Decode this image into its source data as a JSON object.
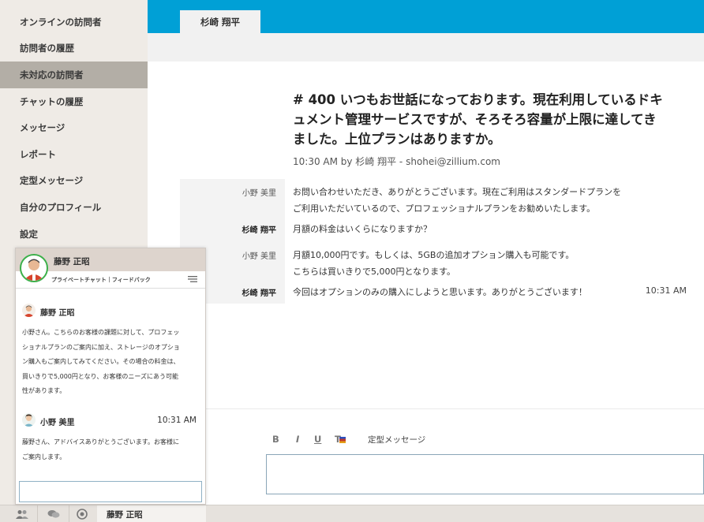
{
  "sidebar": {
    "items": [
      {
        "label": "オンラインの訪問者",
        "active": false
      },
      {
        "label": "訪問者の履歴",
        "active": false
      },
      {
        "label": "未対応の訪問者",
        "active": true
      },
      {
        "label": "チャットの履歴",
        "active": false
      },
      {
        "label": "メッセージ",
        "active": false
      },
      {
        "label": "レポート",
        "active": false
      },
      {
        "label": "定型メッセージ",
        "active": false
      },
      {
        "label": "自分のプロフィール",
        "active": false
      },
      {
        "label": "設定",
        "active": false
      }
    ]
  },
  "topbar": {
    "tab_label": "杉崎 翔平",
    "color": "#00a0d6"
  },
  "conversation": {
    "title": "# 400  いつもお世話になっております。現在利用しているドキュメント管理サービスですが、そろそろ容量が上限に達してきました。上位プランはありますか。",
    "meta": "10:30 AM by 杉崎 翔平 -  shohei@zillium.com",
    "messages": [
      {
        "sender": "小野 美里",
        "lines": [
          "お問い合わせいただき、ありがとうございます。現在ご利用はスタンダードプランを",
          "ご利用いただいているので、プロフェッショナルプランをお勧めいたします。"
        ],
        "time": ""
      },
      {
        "sender": "杉崎 翔平",
        "lines": [
          "月額の料金はいくらになりますか？"
        ],
        "time": ""
      },
      {
        "sender": "小野 美里",
        "lines": [
          "月額10,000円です。もしくは、5GBの追加オプション購入も可能です。",
          "こちらは買いきりで5,000円となります。"
        ],
        "time": ""
      },
      {
        "sender": "杉崎 翔平",
        "lines": [
          "今回はオプションのみの購入にしようと思います。ありがとうございます！"
        ],
        "time": "10:31 AM"
      }
    ]
  },
  "editor": {
    "bold": "B",
    "italic": "I",
    "underline": "U",
    "text_color": "T",
    "template_label": "定型メッセージ"
  },
  "chat_popup": {
    "header_name": "藤野 正昭",
    "links": "プライベートチャット｜フィードバック",
    "messages": [
      {
        "name": "藤野 正昭",
        "time": "",
        "lines": [
          "小野さん。こちらのお客様の課題に対して、プロフェッ",
          "ショナルプランのご案内に加え、ストレージのオプショ",
          "ン購入もご案内してみてください。その場合の料金は、",
          "買いきりで5,000円となり、お客様のニーズにあう可能",
          "性があります。"
        ]
      },
      {
        "name": "小野 美里",
        "time": "10:31 AM",
        "lines": [
          "藤野さん、アドバイスありがとうございます。お客様に",
          "ご案内します。"
        ]
      }
    ]
  },
  "bottombar": {
    "active_chat_name": "藤野 正昭",
    "icons": [
      "users-icon",
      "chat-bubbles-icon",
      "settings-icon"
    ]
  }
}
